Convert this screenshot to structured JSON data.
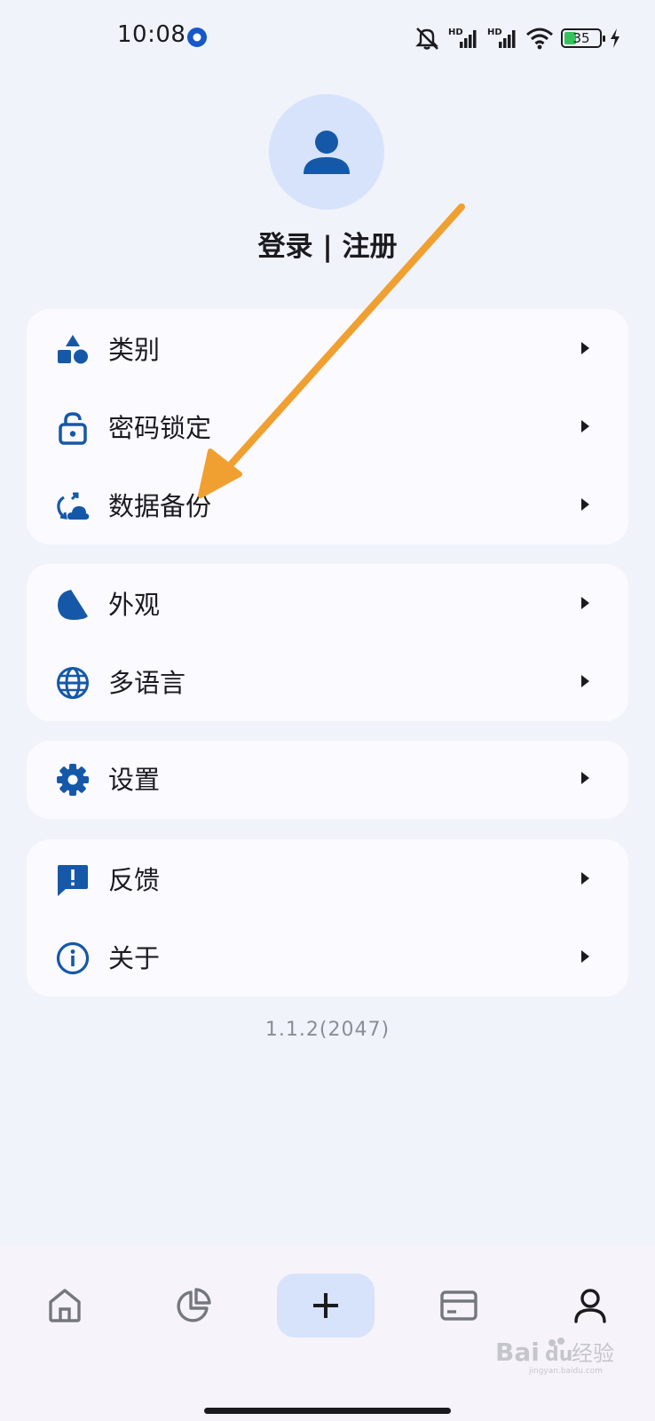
{
  "status_bar": {
    "time": "10:08",
    "icons": [
      "app-notification-icon",
      "mute-icon",
      "hd-signal-icon",
      "hd-signal-icon",
      "wifi-icon",
      "battery-icon",
      "charging-icon"
    ],
    "battery_level": "35",
    "battery_fill_fraction": 0.35,
    "network_labels": [
      "HD",
      "HD"
    ]
  },
  "profile": {
    "avatar_icon": "person-icon",
    "login_label": "登录 | 注册"
  },
  "menu_groups": [
    [
      {
        "label": "类别",
        "icon": "category-shapes-icon"
      },
      {
        "label": "密码锁定",
        "icon": "lock-open-icon"
      },
      {
        "label": "数据备份",
        "icon": "cloud-sync-icon"
      }
    ],
    [
      {
        "label": "外观",
        "icon": "moon-icon"
      },
      {
        "label": "多语言",
        "icon": "globe-icon"
      }
    ],
    [
      {
        "label": "设置",
        "icon": "gear-icon"
      }
    ],
    [
      {
        "label": "反馈",
        "icon": "feedback-icon"
      },
      {
        "label": "关于",
        "icon": "info-icon"
      }
    ]
  ],
  "version": "1.1.2(2047)",
  "bottom_nav": {
    "items": [
      "home-icon",
      "pie-chart-icon",
      "add-icon",
      "card-icon",
      "person-icon"
    ],
    "selected": "person-icon"
  },
  "colors": {
    "accent": "#1558a8",
    "background": "#f1f3fb",
    "card": "#fbfaff",
    "avatar_bg": "#d6e3fb",
    "annotation_arrow": "#f0a030"
  },
  "watermark": {
    "text_latin": "Bai",
    "text_latin2": "du",
    "text_cn": "经验",
    "subtext": "jingyan.baidu.com"
  }
}
